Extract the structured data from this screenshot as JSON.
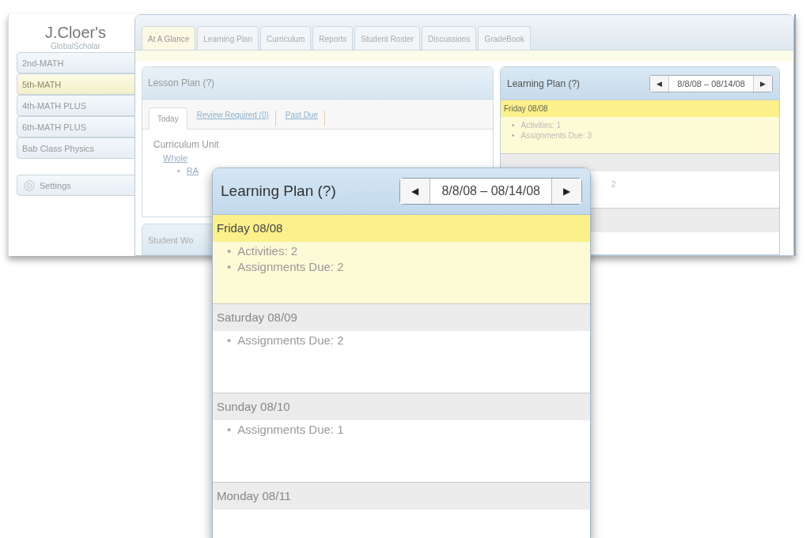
{
  "sidebar": {
    "logo": "J.Cloer's",
    "tagline": "GlobalScholar",
    "items": [
      {
        "label": "2nd-MATH",
        "selected": false
      },
      {
        "label": "5th-MATH",
        "selected": true
      },
      {
        "label": "4th-MATH PLUS",
        "selected": false
      },
      {
        "label": "6th-MATH PLUS",
        "selected": false
      },
      {
        "label": "Bab Class Physics",
        "selected": false
      }
    ],
    "settings": "Settings"
  },
  "tabs": [
    {
      "label": "At A Glance",
      "selected": true
    },
    {
      "label": "Learning Plan",
      "selected": false
    },
    {
      "label": "Curriculum",
      "selected": false
    },
    {
      "label": "Reports",
      "selected": false
    },
    {
      "label": "Student Roster",
      "selected": false
    },
    {
      "label": "Discussions",
      "selected": false
    },
    {
      "label": "GradeBook",
      "selected": false
    }
  ],
  "lesson_plan": {
    "title": "Lesson Plan (?)",
    "tabs": [
      {
        "label": "Today",
        "selected": true
      },
      {
        "label": "Review Required (0)",
        "selected": false
      },
      {
        "label": "Past Due",
        "selected": false
      }
    ],
    "heading": "Curriculum Unit",
    "unit_link": "Whole",
    "items": [
      {
        "bullet": "•",
        "text": "RA"
      }
    ]
  },
  "next_panel": {
    "title": "Student Wo"
  },
  "learning_plan": {
    "title": "Learning Plan (?)",
    "prev": "◀",
    "range": "8/8/08 – 08/14/08",
    "next": "▶",
    "days": [
      {
        "label": "Friday 08/08",
        "highlighted": true,
        "items": [
          {
            "bullet": "•",
            "text": "Activities: 1"
          },
          {
            "bullet": "•",
            "text": "Assignments Due: 3"
          }
        ]
      }
    ],
    "covered_items": [
      "2"
    ]
  },
  "callout": {
    "title": "Learning Plan (?)",
    "prev": "◀",
    "range": "8/8/08 – 08/14/08",
    "next": "▶",
    "days": [
      {
        "label": "Friday 08/08",
        "highlighted": true,
        "items": [
          {
            "bullet": "•",
            "text": "Activities: 2"
          },
          {
            "bullet": "•",
            "text": "Assignments Due: 2"
          }
        ]
      },
      {
        "label": "Saturday 08/09",
        "highlighted": false,
        "items": [
          {
            "bullet": "•",
            "text": "Assignments Due: 2"
          }
        ]
      },
      {
        "label": "Sunday 08/10",
        "highlighted": false,
        "items": [
          {
            "bullet": "•",
            "text": "Assignments Due: 1"
          }
        ]
      },
      {
        "label": "Monday 08/11",
        "highlighted": false
      }
    ]
  }
}
